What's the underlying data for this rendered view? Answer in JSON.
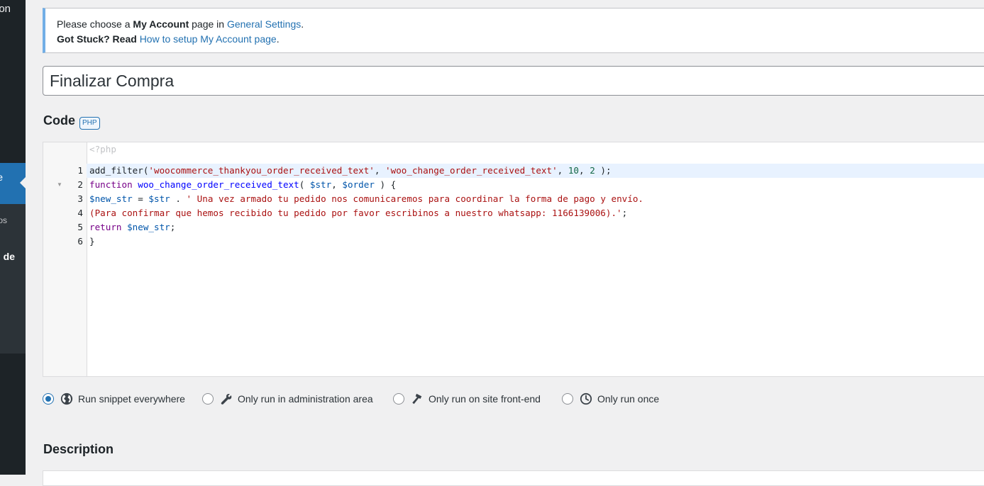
{
  "sidebar": {
    "menu_text_top": "on",
    "current_item_text": "e",
    "submenu_item_1": "os",
    "submenu_item_2": "de"
  },
  "notice": {
    "line1_prefix": "Please choose a ",
    "line1_bold": "My Account",
    "line1_mid": " page in ",
    "line1_link": "General Settings",
    "line1_suffix": ".",
    "line2_bold": "Got Stuck? Read",
    "line2_link": "How to setup My Account page",
    "line2_suffix": "."
  },
  "snippet": {
    "title": "Finalizar Compra"
  },
  "code_section": {
    "heading": "Code",
    "language_badge": "PHP",
    "header_line": "<?php",
    "line_numbers": [
      "1",
      "2",
      "3",
      "4",
      "5",
      "6"
    ],
    "lines": [
      [
        [
          "tk-fn",
          "add_filter("
        ],
        [
          "tk-str",
          "'woocommerce_thankyou_order_received_text'"
        ],
        [
          "tk-plain",
          ", "
        ],
        [
          "tk-str",
          "'woo_change_order_received_text'"
        ],
        [
          "tk-plain",
          ", "
        ],
        [
          "tk-num",
          "10"
        ],
        [
          "tk-plain",
          ", "
        ],
        [
          "tk-num",
          "2"
        ],
        [
          "tk-plain",
          " );"
        ]
      ],
      [
        [
          "tk-kw",
          "function "
        ],
        [
          "tk-def",
          "woo_change_order_received_text"
        ],
        [
          "tk-plain",
          "( "
        ],
        [
          "tk-var",
          "$str"
        ],
        [
          "tk-plain",
          ", "
        ],
        [
          "tk-var",
          "$order"
        ],
        [
          "tk-plain",
          " ) {"
        ]
      ],
      [
        [
          "tk-var",
          "$new_str"
        ],
        [
          "tk-plain",
          " = "
        ],
        [
          "tk-var",
          "$str"
        ],
        [
          "tk-plain",
          " . "
        ],
        [
          "tk-str",
          "' Una vez armado tu pedido nos comunicaremos para coordinar la forma de pago y envío."
        ]
      ],
      [
        [
          "tk-str",
          "(Para confirmar que hemos recibido tu pedido por favor escribinos a nuestro whatsapp: 1166139006).'"
        ],
        [
          "tk-plain",
          ";"
        ]
      ],
      [
        [
          "tk-kw",
          "return "
        ],
        [
          "tk-var",
          "$new_str"
        ],
        [
          "tk-plain",
          ";"
        ]
      ],
      [
        [
          "tk-plain",
          "}"
        ]
      ]
    ]
  },
  "scope_options": [
    {
      "label": "Run snippet everywhere",
      "icon": "globe-icon",
      "checked": true
    },
    {
      "label": "Only run in administration area",
      "icon": "wrench-icon",
      "checked": false
    },
    {
      "label": "Only run on site front-end",
      "icon": "hammer-icon",
      "checked": false
    },
    {
      "label": "Only run once",
      "icon": "clock-icon",
      "checked": false
    }
  ],
  "description": {
    "heading": "Description"
  },
  "colors": {
    "accent": "#2271b1",
    "notice_border": "#72aee6",
    "sidebar": "#1d2327",
    "active_line": "#e8f2ff"
  }
}
